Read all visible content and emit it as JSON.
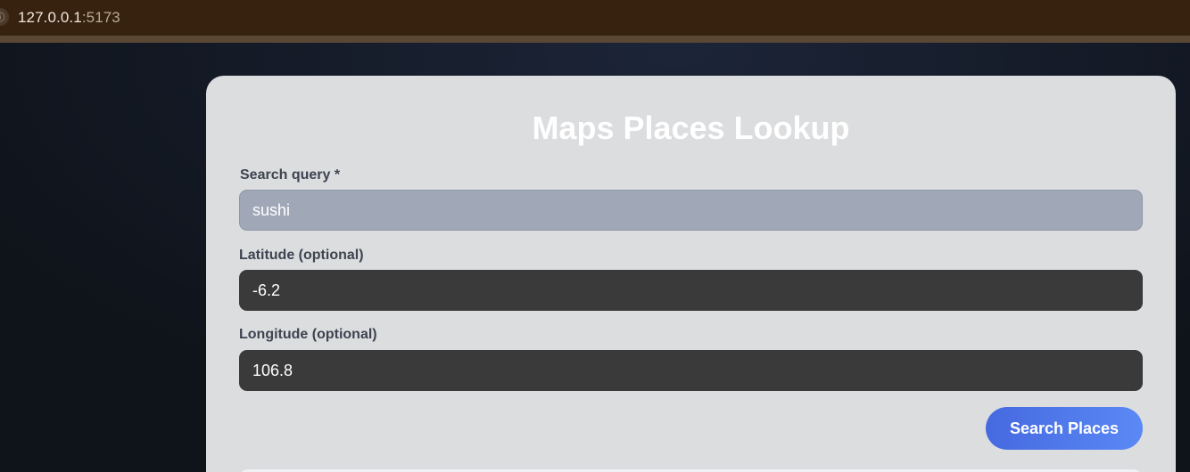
{
  "browser": {
    "url_host": "127.0.0.1",
    "url_port": ":5173"
  },
  "app": {
    "title": "Maps Places Lookup"
  },
  "form": {
    "query_label": "Search query *",
    "query_value": "sushi",
    "lat_label": "Latitude (optional)",
    "lat_value": "-6.2",
    "lng_label": "Longitude (optional)",
    "lng_value": "106.8",
    "submit_label": "Search Places"
  }
}
